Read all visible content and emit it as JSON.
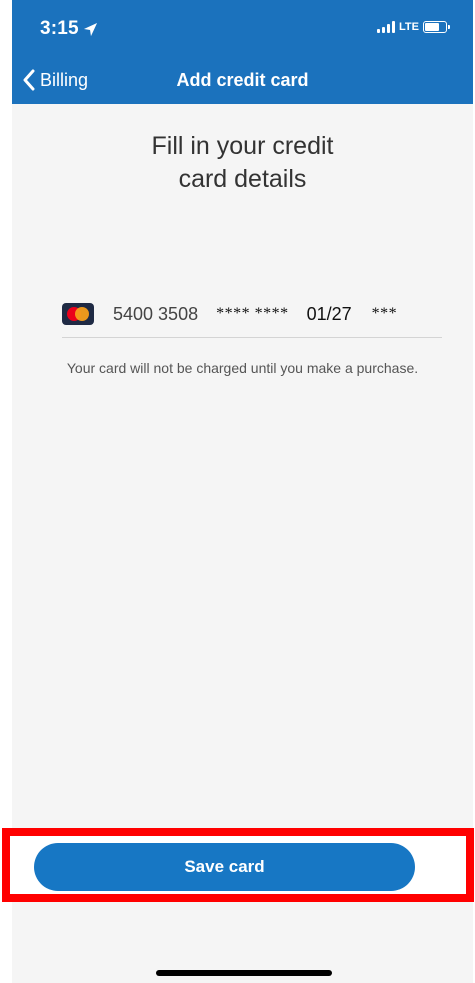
{
  "status_bar": {
    "time": "3:15",
    "network": "LTE",
    "icons": [
      "location-arrow-icon",
      "signal-icon",
      "battery-icon"
    ]
  },
  "nav": {
    "back_label": "Billing",
    "title": "Add credit card"
  },
  "heading": {
    "line1": "Fill in your credit",
    "line2": "card details"
  },
  "card": {
    "brand_icon": "mastercard-icon",
    "number": "5400 3508",
    "masked": "**** ****",
    "expiry": "01/27",
    "cvc": "***"
  },
  "notice": "Your card will not be charged until you make a purchase.",
  "save_button": {
    "label": "Save card"
  },
  "colors": {
    "brand_blue": "#1b72bd",
    "button_blue": "#1777c4",
    "highlight_red": "#ff0000",
    "background": "#f5f5f5"
  }
}
